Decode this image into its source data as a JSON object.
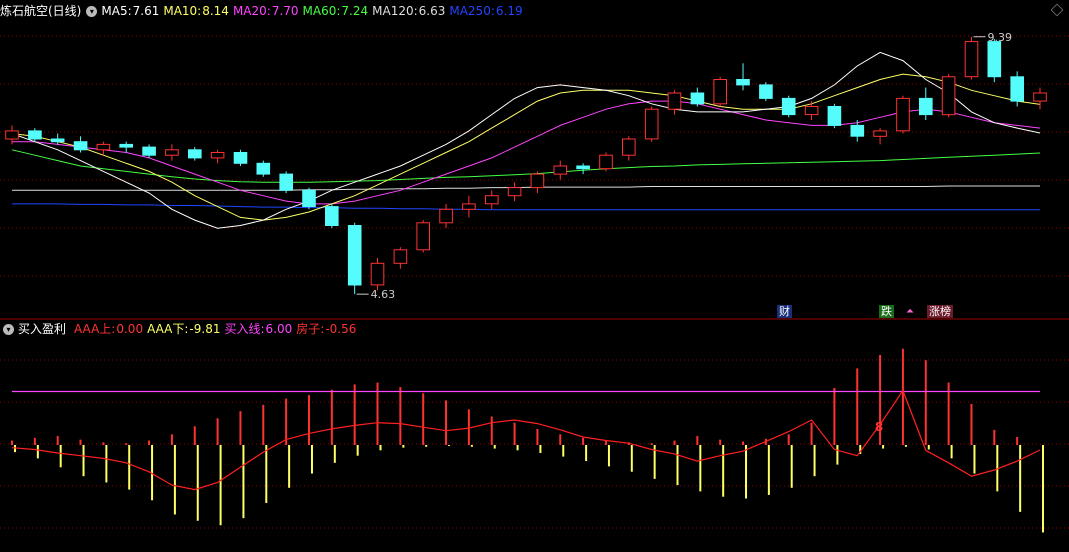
{
  "main": {
    "title": "炼石航空(日线)",
    "ma": [
      {
        "label": "MA5:",
        "value": "7.61",
        "color": "#ffffff"
      },
      {
        "label": "MA10:",
        "value": "8.14",
        "color": "#ffff66"
      },
      {
        "label": "MA20:",
        "value": "7.70",
        "color": "#ff44ff"
      },
      {
        "label": "MA60:",
        "value": "7.24",
        "color": "#44ff44"
      },
      {
        "label": "MA120:",
        "value": "6.63",
        "color": "#dddddd"
      },
      {
        "label": "MA250:",
        "value": "6.19",
        "color": "#2244ff"
      }
    ],
    "high_label": "9.39",
    "low_label": "4.63",
    "markers": {
      "cai": "财",
      "die": "跌",
      "zhangbang": "涨榜"
    }
  },
  "sub": {
    "title": "买入盈利",
    "items": [
      {
        "label": "AAA上:",
        "value": "0.00",
        "color": "#ff3333"
      },
      {
        "label": "AAA下:",
        "value": "-9.81",
        "color": "#ffff66"
      },
      {
        "label": "买入线:",
        "value": "6.00",
        "color": "#ff44ff"
      },
      {
        "label": "房子:",
        "value": "-0.56",
        "color": "#ff3333"
      }
    ],
    "signal": "8"
  },
  "colors": {
    "up": "#ff3232",
    "down": "#54fcfc",
    "grid": "#8b0000",
    "divider": "#a00000"
  },
  "chart_data": [
    {
      "type": "candlestick",
      "title": "炼石航空(日线)",
      "ylim": [
        4.3,
        9.7
      ],
      "series": [
        {
          "name": "MA5",
          "values": [
            7.6,
            7.45,
            7.3,
            7.1,
            6.9,
            6.7,
            6.5,
            6.2,
            6.0,
            5.85,
            5.9,
            6.0,
            6.2,
            6.35,
            6.55,
            6.7,
            6.85,
            7.0,
            7.2,
            7.4,
            7.65,
            7.95,
            8.25,
            8.45,
            8.5,
            8.45,
            8.4,
            8.3,
            8.15,
            8.05,
            8.0,
            8.0,
            8.0,
            8.05,
            8.1,
            8.25,
            8.5,
            8.85,
            9.1,
            8.95,
            8.6,
            8.35,
            8.0,
            7.8,
            7.7,
            7.61
          ]
        },
        {
          "name": "MA10",
          "values": [
            7.6,
            7.55,
            7.45,
            7.35,
            7.2,
            7.05,
            6.9,
            6.7,
            6.45,
            6.25,
            6.05,
            6.0,
            6.05,
            6.15,
            6.3,
            6.45,
            6.65,
            6.85,
            7.05,
            7.25,
            7.45,
            7.7,
            7.95,
            8.2,
            8.35,
            8.4,
            8.4,
            8.4,
            8.35,
            8.3,
            8.2,
            8.1,
            8.05,
            8.05,
            8.05,
            8.15,
            8.3,
            8.45,
            8.6,
            8.7,
            8.65,
            8.55,
            8.4,
            8.3,
            8.2,
            8.14
          ]
        },
        {
          "name": "MA20",
          "values": [
            7.45,
            7.45,
            7.4,
            7.35,
            7.3,
            7.25,
            7.15,
            7.0,
            6.85,
            6.7,
            6.55,
            6.45,
            6.35,
            6.3,
            6.3,
            6.35,
            6.45,
            6.55,
            6.7,
            6.85,
            7.0,
            7.15,
            7.35,
            7.55,
            7.75,
            7.9,
            8.05,
            8.15,
            8.2,
            8.2,
            8.15,
            8.05,
            7.95,
            7.85,
            7.8,
            7.75,
            7.75,
            7.8,
            7.9,
            8.0,
            8.05,
            8.0,
            7.9,
            7.8,
            7.75,
            7.7
          ]
        },
        {
          "name": "MA60",
          "values": [
            7.3,
            7.2,
            7.1,
            7.0,
            6.95,
            6.9,
            6.85,
            6.8,
            6.76,
            6.73,
            6.71,
            6.7,
            6.7,
            6.7,
            6.71,
            6.72,
            6.73,
            6.75,
            6.77,
            6.79,
            6.8,
            6.82,
            6.84,
            6.86,
            6.89,
            6.92,
            6.95,
            6.97,
            6.99,
            7.0,
            7.02,
            7.03,
            7.04,
            7.05,
            7.06,
            7.07,
            7.08,
            7.09,
            7.1,
            7.12,
            7.14,
            7.16,
            7.18,
            7.2,
            7.22,
            7.24
          ]
        },
        {
          "name": "MA120",
          "values": [
            6.55,
            6.55,
            6.55,
            6.55,
            6.55,
            6.55,
            6.55,
            6.55,
            6.55,
            6.55,
            6.55,
            6.55,
            6.55,
            6.56,
            6.56,
            6.57,
            6.57,
            6.58,
            6.58,
            6.59,
            6.59,
            6.6,
            6.6,
            6.61,
            6.61,
            6.61,
            6.61,
            6.61,
            6.62,
            6.62,
            6.62,
            6.62,
            6.62,
            6.62,
            6.62,
            6.62,
            6.62,
            6.62,
            6.62,
            6.62,
            6.62,
            6.63,
            6.63,
            6.63,
            6.63,
            6.63
          ]
        },
        {
          "name": "MA250",
          "values": [
            6.3,
            6.3,
            6.3,
            6.29,
            6.29,
            6.28,
            6.28,
            6.27,
            6.27,
            6.26,
            6.25,
            6.24,
            6.24,
            6.23,
            6.23,
            6.22,
            6.22,
            6.21,
            6.21,
            6.2,
            6.2,
            6.19,
            6.19,
            6.19,
            6.19,
            6.19,
            6.19,
            6.19,
            6.19,
            6.19,
            6.19,
            6.19,
            6.19,
            6.19,
            6.19,
            6.19,
            6.19,
            6.19,
            6.19,
            6.19,
            6.19,
            6.19,
            6.19,
            6.19,
            6.19,
            6.19
          ]
        }
      ],
      "candles": [
        {
          "o": 7.5,
          "h": 7.75,
          "l": 7.4,
          "c": 7.65
        },
        {
          "o": 7.65,
          "h": 7.7,
          "l": 7.45,
          "c": 7.5
        },
        {
          "o": 7.5,
          "h": 7.6,
          "l": 7.4,
          "c": 7.45
        },
        {
          "o": 7.45,
          "h": 7.55,
          "l": 7.25,
          "c": 7.3
        },
        {
          "o": 7.3,
          "h": 7.45,
          "l": 7.2,
          "c": 7.4
        },
        {
          "o": 7.4,
          "h": 7.45,
          "l": 7.25,
          "c": 7.35
        },
        {
          "o": 7.35,
          "h": 7.4,
          "l": 7.15,
          "c": 7.2
        },
        {
          "o": 7.2,
          "h": 7.4,
          "l": 7.1,
          "c": 7.3
        },
        {
          "o": 7.3,
          "h": 7.35,
          "l": 7.1,
          "c": 7.15
        },
        {
          "o": 7.15,
          "h": 7.3,
          "l": 7.05,
          "c": 7.25
        },
        {
          "o": 7.25,
          "h": 7.3,
          "l": 7.0,
          "c": 7.05
        },
        {
          "o": 7.05,
          "h": 7.1,
          "l": 6.8,
          "c": 6.85
        },
        {
          "o": 6.85,
          "h": 6.9,
          "l": 6.5,
          "c": 6.55
        },
        {
          "o": 6.55,
          "h": 6.6,
          "l": 6.2,
          "c": 6.25
        },
        {
          "o": 6.25,
          "h": 6.3,
          "l": 5.85,
          "c": 5.9
        },
        {
          "o": 5.9,
          "h": 5.95,
          "l": 4.63,
          "c": 4.8
        },
        {
          "o": 4.8,
          "h": 5.3,
          "l": 4.7,
          "c": 5.2
        },
        {
          "o": 5.2,
          "h": 5.5,
          "l": 5.1,
          "c": 5.45
        },
        {
          "o": 5.45,
          "h": 6.0,
          "l": 5.4,
          "c": 5.95
        },
        {
          "o": 5.95,
          "h": 6.3,
          "l": 5.85,
          "c": 6.2
        },
        {
          "o": 6.2,
          "h": 6.45,
          "l": 6.05,
          "c": 6.3
        },
        {
          "o": 6.3,
          "h": 6.55,
          "l": 6.2,
          "c": 6.45
        },
        {
          "o": 6.45,
          "h": 6.7,
          "l": 6.35,
          "c": 6.6
        },
        {
          "o": 6.6,
          "h": 6.9,
          "l": 6.5,
          "c": 6.85
        },
        {
          "o": 6.85,
          "h": 7.1,
          "l": 6.75,
          "c": 7.0
        },
        {
          "o": 7.0,
          "h": 7.05,
          "l": 6.85,
          "c": 6.95
        },
        {
          "o": 6.95,
          "h": 7.25,
          "l": 6.9,
          "c": 7.2
        },
        {
          "o": 7.2,
          "h": 7.55,
          "l": 7.1,
          "c": 7.5
        },
        {
          "o": 7.5,
          "h": 8.1,
          "l": 7.45,
          "c": 8.05
        },
        {
          "o": 8.05,
          "h": 8.4,
          "l": 7.95,
          "c": 8.35
        },
        {
          "o": 8.35,
          "h": 8.45,
          "l": 8.1,
          "c": 8.15
        },
        {
          "o": 8.15,
          "h": 8.65,
          "l": 8.1,
          "c": 8.6
        },
        {
          "o": 8.6,
          "h": 8.9,
          "l": 8.4,
          "c": 8.5
        },
        {
          "o": 8.5,
          "h": 8.55,
          "l": 8.2,
          "c": 8.25
        },
        {
          "o": 8.25,
          "h": 8.3,
          "l": 7.9,
          "c": 7.95
        },
        {
          "o": 7.95,
          "h": 8.2,
          "l": 7.85,
          "c": 8.1
        },
        {
          "o": 8.1,
          "h": 8.15,
          "l": 7.7,
          "c": 7.75
        },
        {
          "o": 7.75,
          "h": 7.85,
          "l": 7.45,
          "c": 7.55
        },
        {
          "o": 7.55,
          "h": 7.7,
          "l": 7.4,
          "c": 7.65
        },
        {
          "o": 7.65,
          "h": 8.3,
          "l": 7.6,
          "c": 8.25
        },
        {
          "o": 8.25,
          "h": 8.45,
          "l": 7.85,
          "c": 7.95
        },
        {
          "o": 7.95,
          "h": 8.7,
          "l": 7.9,
          "c": 8.65
        },
        {
          "o": 8.65,
          "h": 9.39,
          "l": 8.6,
          "c": 9.3
        },
        {
          "o": 9.3,
          "h": 9.35,
          "l": 8.55,
          "c": 8.65
        },
        {
          "o": 8.65,
          "h": 8.75,
          "l": 8.1,
          "c": 8.2
        },
        {
          "o": 8.2,
          "h": 8.45,
          "l": 8.05,
          "c": 8.35
        }
      ]
    },
    {
      "type": "bar",
      "title": "买入盈利",
      "ylim": [
        -12,
        12
      ],
      "series": [
        {
          "name": "AAA上",
          "values": [
            0.5,
            0.8,
            1.0,
            0.6,
            0.3,
            0.2,
            0.5,
            1.2,
            2.1,
            3.0,
            3.8,
            4.5,
            5.2,
            5.6,
            6.2,
            6.8,
            7.0,
            6.5,
            5.8,
            5.0,
            4.0,
            3.2,
            2.5,
            1.8,
            1.2,
            0.8,
            0.5,
            0.3,
            0.2,
            0.5,
            1.0,
            0.6,
            0.4,
            0.7,
            1.2,
            2.5,
            6.4,
            8.6,
            10.1,
            10.8,
            9.5,
            7.0,
            4.6,
            1.7,
            0.9,
            0.0
          ]
        },
        {
          "name": "AAA下",
          "values": [
            -0.8,
            -1.5,
            -2.5,
            -3.5,
            -4.2,
            -5.0,
            -6.2,
            -7.8,
            -8.5,
            -9.0,
            -8.2,
            -6.5,
            -4.8,
            -3.2,
            -2.0,
            -1.2,
            -0.6,
            -0.3,
            -0.2,
            -0.1,
            -0.2,
            -0.4,
            -0.6,
            -0.9,
            -1.3,
            -1.8,
            -2.4,
            -3.0,
            -3.8,
            -4.5,
            -5.2,
            -5.8,
            -6.0,
            -5.6,
            -4.8,
            -3.5,
            -2.2,
            -1.0,
            -0.4,
            -0.2,
            -0.5,
            -1.5,
            -3.2,
            -5.2,
            -7.5,
            -9.81
          ]
        },
        {
          "name": "买入线",
          "values": [
            6,
            6,
            6,
            6,
            6,
            6,
            6,
            6,
            6,
            6,
            6,
            6,
            6,
            6,
            6,
            6,
            6,
            6,
            6,
            6,
            6,
            6,
            6,
            6,
            6,
            6,
            6,
            6,
            6,
            6,
            6,
            6,
            6,
            6,
            6,
            6,
            6,
            6,
            6,
            6,
            6,
            6,
            6,
            6,
            6,
            6
          ]
        },
        {
          "name": "房子",
          "values": [
            -0.3,
            -0.5,
            -0.9,
            -1.2,
            -1.5,
            -2.0,
            -3.0,
            -4.5,
            -5.0,
            -4.2,
            -2.5,
            -0.8,
            0.6,
            1.3,
            1.8,
            2.2,
            2.5,
            2.4,
            2.0,
            1.6,
            1.9,
            2.5,
            2.8,
            2.4,
            1.7,
            0.9,
            0.5,
            0.2,
            -0.5,
            -1.0,
            -1.8,
            -1.2,
            -0.7,
            0.4,
            1.5,
            2.8,
            -0.5,
            -1.2,
            2.3,
            6.1,
            -0.6,
            -2.0,
            -3.5,
            -2.8,
            -1.8,
            -0.56
          ]
        }
      ]
    }
  ]
}
